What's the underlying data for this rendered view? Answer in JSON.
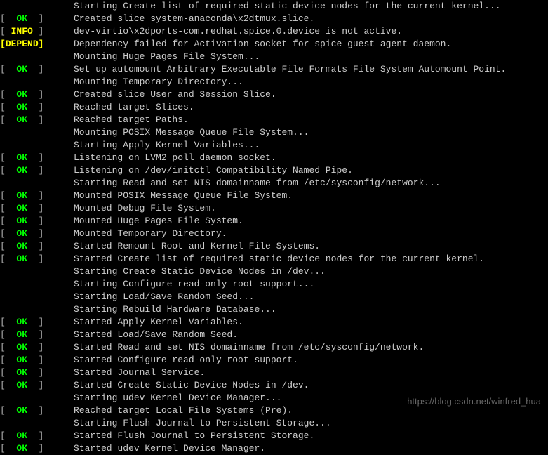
{
  "watermark": "https://blog.csdn.net/winfred_hua",
  "lines": [
    {
      "status": null,
      "text": "Starting Create list of required static device nodes for the current kernel..."
    },
    {
      "status": "OK",
      "text": "Created slice system-anaconda\\x2dtmux.slice."
    },
    {
      "status": "INFO",
      "text": "dev-virtio\\x2dports-com.redhat.spice.0.device is not active."
    },
    {
      "status": "DEPEND",
      "text": "Dependency failed for Activation socket for spice guest agent daemon."
    },
    {
      "status": null,
      "text": "Mounting Huge Pages File System..."
    },
    {
      "status": "OK",
      "text": "Set up automount Arbitrary Executable File Formats File System Automount Point."
    },
    {
      "status": null,
      "text": "Mounting Temporary Directory..."
    },
    {
      "status": "OK",
      "text": "Created slice User and Session Slice."
    },
    {
      "status": "OK",
      "text": "Reached target Slices."
    },
    {
      "status": "OK",
      "text": "Reached target Paths."
    },
    {
      "status": null,
      "text": "Mounting POSIX Message Queue File System..."
    },
    {
      "status": null,
      "text": "Starting Apply Kernel Variables..."
    },
    {
      "status": "OK",
      "text": "Listening on LVM2 poll daemon socket."
    },
    {
      "status": "OK",
      "text": "Listening on /dev/initctl Compatibility Named Pipe."
    },
    {
      "status": null,
      "text": "Starting Read and set NIS domainname from /etc/sysconfig/network..."
    },
    {
      "status": "OK",
      "text": "Mounted POSIX Message Queue File System."
    },
    {
      "status": "OK",
      "text": "Mounted Debug File System."
    },
    {
      "status": "OK",
      "text": "Mounted Huge Pages File System."
    },
    {
      "status": "OK",
      "text": "Mounted Temporary Directory."
    },
    {
      "status": "OK",
      "text": "Started Remount Root and Kernel File Systems."
    },
    {
      "status": "OK",
      "text": "Started Create list of required static device nodes for the current kernel."
    },
    {
      "status": null,
      "text": "Starting Create Static Device Nodes in /dev..."
    },
    {
      "status": null,
      "text": "Starting Configure read-only root support..."
    },
    {
      "status": null,
      "text": "Starting Load/Save Random Seed..."
    },
    {
      "status": null,
      "text": "Starting Rebuild Hardware Database..."
    },
    {
      "status": "OK",
      "text": "Started Apply Kernel Variables."
    },
    {
      "status": "OK",
      "text": "Started Load/Save Random Seed."
    },
    {
      "status": "OK",
      "text": "Started Read and set NIS domainname from /etc/sysconfig/network."
    },
    {
      "status": "OK",
      "text": "Started Configure read-only root support."
    },
    {
      "status": "OK",
      "text": "Started Journal Service."
    },
    {
      "status": "OK",
      "text": "Started Create Static Device Nodes in /dev."
    },
    {
      "status": null,
      "text": "Starting udev Kernel Device Manager..."
    },
    {
      "status": "OK",
      "text": "Reached target Local File Systems (Pre)."
    },
    {
      "status": null,
      "text": "Starting Flush Journal to Persistent Storage..."
    },
    {
      "status": "OK",
      "text": "Started Flush Journal to Persistent Storage."
    },
    {
      "status": "OK",
      "text": "Started udev Kernel Device Manager."
    }
  ]
}
